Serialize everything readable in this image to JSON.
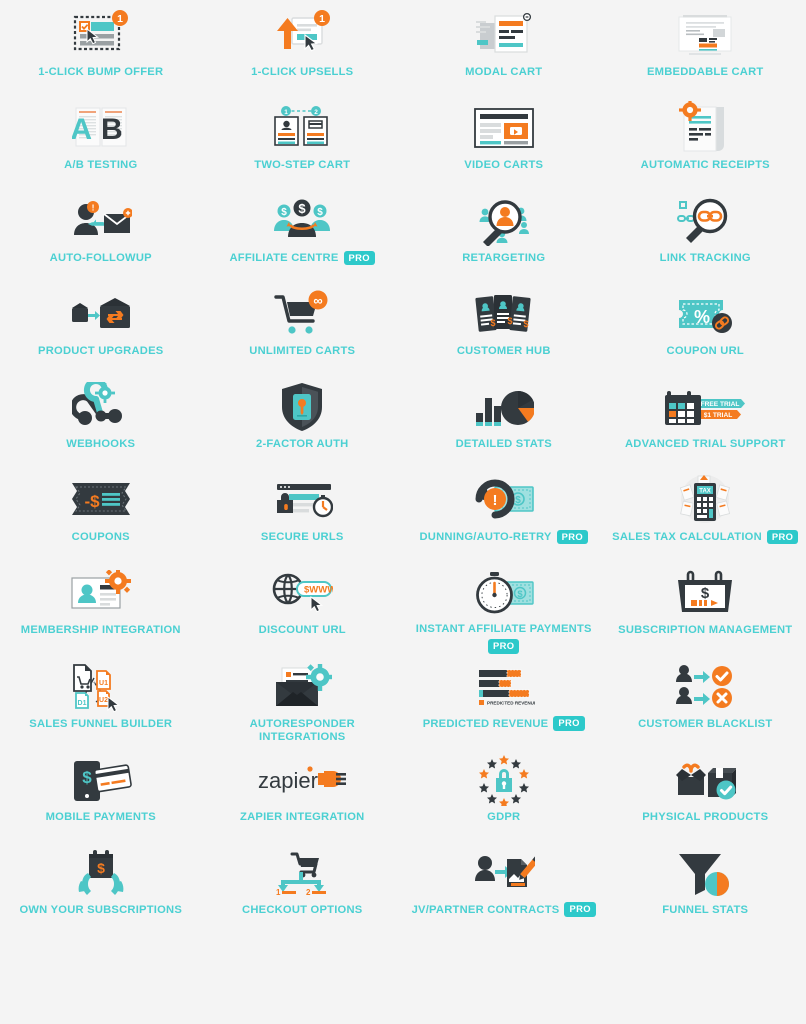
{
  "page": {
    "background_color": "#f4f4f4",
    "label_color": "#4bd0d2",
    "badge_color": "#2dc9ca",
    "accent_orange": "#f47b20",
    "accent_dark": "#333a3f",
    "columns": 4,
    "rows": 11
  },
  "badges": {
    "pro": "PRO"
  },
  "features": [
    {
      "label": "1-CLICK BUMP OFFER",
      "icon": "bump-offer-icon",
      "pro": false
    },
    {
      "label": "1-CLICK UPSELLS",
      "icon": "upsell-icon",
      "pro": false
    },
    {
      "label": "MODAL CART",
      "icon": "modal-cart-icon",
      "pro": false
    },
    {
      "label": "EMBEDDABLE CART",
      "icon": "embeddable-cart-icon",
      "pro": false
    },
    {
      "label": "A/B TESTING",
      "icon": "ab-testing-icon",
      "pro": false
    },
    {
      "label": "TWO-STEP CART",
      "icon": "two-step-cart-icon",
      "pro": false
    },
    {
      "label": "VIDEO CARTS",
      "icon": "video-cart-icon",
      "pro": false
    },
    {
      "label": "AUTOMATIC RECEIPTS",
      "icon": "receipt-icon",
      "pro": false
    },
    {
      "label": "AUTO-FOLLOWUP",
      "icon": "auto-followup-icon",
      "pro": false
    },
    {
      "label": "AFFILIATE CENTRE",
      "icon": "affiliate-centre-icon",
      "pro": true
    },
    {
      "label": "RETARGETING",
      "icon": "retargeting-icon",
      "pro": false
    },
    {
      "label": "LINK TRACKING",
      "icon": "link-tracking-icon",
      "pro": false
    },
    {
      "label": "PRODUCT UPGRADES",
      "icon": "product-upgrades-icon",
      "pro": false
    },
    {
      "label": "UNLIMITED CARTS",
      "icon": "unlimited-carts-icon",
      "pro": false
    },
    {
      "label": "CUSTOMER HUB",
      "icon": "customer-hub-icon",
      "pro": false
    },
    {
      "label": "COUPON URL",
      "icon": "coupon-url-icon",
      "pro": false
    },
    {
      "label": "WEBHOOKS",
      "icon": "webhooks-icon",
      "pro": false
    },
    {
      "label": "2-FACTOR AUTH",
      "icon": "two-factor-auth-icon",
      "pro": false
    },
    {
      "label": "DETAILED STATS",
      "icon": "detailed-stats-icon",
      "pro": false
    },
    {
      "label": "ADVANCED TRIAL SUPPORT",
      "icon": "trial-support-icon",
      "pro": false
    },
    {
      "label": "COUPONS",
      "icon": "coupons-icon",
      "pro": false
    },
    {
      "label": "SECURE URLS",
      "icon": "secure-urls-icon",
      "pro": false
    },
    {
      "label": "DUNNING/AUTO-RETRY",
      "icon": "dunning-icon",
      "pro": true
    },
    {
      "label": "SALES TAX CALCULATION",
      "icon": "sales-tax-icon",
      "pro": true
    },
    {
      "label": "MEMBERSHIP INTEGRATION",
      "icon": "membership-icon",
      "pro": false
    },
    {
      "label": "DISCOUNT URL",
      "icon": "discount-url-icon",
      "pro": false
    },
    {
      "label": "INSTANT AFFILIATE PAYMENTS",
      "icon": "instant-affiliate-payments-icon",
      "pro": true,
      "stack": true
    },
    {
      "label": "SUBSCRIPTION MANAGEMENT",
      "icon": "subscription-management-icon",
      "pro": false
    },
    {
      "label": "SALES FUNNEL BUILDER",
      "icon": "sales-funnel-builder-icon",
      "pro": false
    },
    {
      "label": "AUTORESPONDER\nINTEGRATIONS",
      "icon": "autoresponder-icon",
      "pro": false
    },
    {
      "label": "PREDICTED REVENUE",
      "icon": "predicted-revenue-icon",
      "pro": true
    },
    {
      "label": "CUSTOMER BLACKLIST",
      "icon": "customer-blacklist-icon",
      "pro": false
    },
    {
      "label": "MOBILE PAYMENTS",
      "icon": "mobile-payments-icon",
      "pro": false
    },
    {
      "label": "ZAPIER INTEGRATION",
      "icon": "zapier-icon",
      "pro": false
    },
    {
      "label": "GDPR",
      "icon": "gdpr-icon",
      "pro": false
    },
    {
      "label": "PHYSICAL PRODUCTS",
      "icon": "physical-products-icon",
      "pro": false
    },
    {
      "label": "OWN YOUR SUBSCRIPTIONS",
      "icon": "own-subscriptions-icon",
      "pro": false
    },
    {
      "label": "CHECKOUT OPTIONS",
      "icon": "checkout-options-icon",
      "pro": false
    },
    {
      "label": "JV/PARTNER CONTRACTS",
      "icon": "jv-partner-contracts-icon",
      "pro": true
    },
    {
      "label": "FUNNEL STATS",
      "icon": "funnel-stats-icon",
      "pro": false
    }
  ],
  "icon_text": {
    "ab_testing_a": "A",
    "ab_testing_b": "B",
    "unlimited": "∞",
    "free_trial": "FREE TRIAL",
    "dollar_trial": "$1 TRIAL",
    "tax": "TAX",
    "www": "$WWW",
    "funnel_u1": "U1",
    "funnel_d1": "D1",
    "funnel_u2": "U2",
    "predicted_revenue_legend": "PREDICTED REVENUE",
    "zapier_wordmark": "zapier",
    "step_one": "1",
    "step_two": "2",
    "badge_one": "1",
    "percent": "%",
    "dollar": "$",
    "minus_dollar": "-$",
    "exclaim": "!"
  }
}
